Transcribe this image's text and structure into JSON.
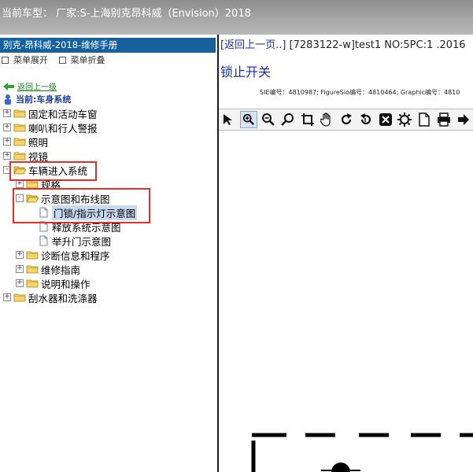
{
  "topbar": {
    "title": "当前车型： 厂家:S-上海别克昂科威（Envision）2018"
  },
  "left": {
    "manual_title": "别克-昂科威-2018-维修手册",
    "menu": [
      "菜单展开",
      "菜单折叠"
    ],
    "back_link": "返回上一级",
    "current": "当前:车身系统",
    "tree": [
      {
        "label": "固定和活动车窗",
        "level": 0,
        "type": "folder",
        "state": "+"
      },
      {
        "label": "喇叭和行人警报",
        "level": 0,
        "type": "folder",
        "state": "+"
      },
      {
        "label": "照明",
        "level": 0,
        "type": "folder",
        "state": "+"
      },
      {
        "label": "视镜",
        "level": 0,
        "type": "folder",
        "state": "+"
      },
      {
        "label": "车辆进入系统",
        "level": 0,
        "type": "folder-open",
        "state": "-"
      },
      {
        "label": "规格",
        "level": 1,
        "type": "folder",
        "state": "+"
      },
      {
        "label": "示意图和布线图",
        "level": 1,
        "type": "folder-open",
        "state": "-"
      },
      {
        "label": "门锁/指示灯示意图",
        "level": 2,
        "type": "doc",
        "state": ""
      },
      {
        "label": "释放系统示意图",
        "level": 2,
        "type": "doc",
        "state": ""
      },
      {
        "label": "举升门示意图",
        "level": 2,
        "type": "doc",
        "state": ""
      },
      {
        "label": "诊断信息和程序",
        "level": 1,
        "type": "folder",
        "state": "+"
      },
      {
        "label": "维修指南",
        "level": 1,
        "type": "folder",
        "state": "+"
      },
      {
        "label": "说明和操作",
        "level": 1,
        "type": "folder",
        "state": "+"
      },
      {
        "label": "刮水器和洗涤器",
        "level": 0,
        "type": "folder",
        "state": "+"
      }
    ]
  },
  "right": {
    "breadcrumb_back": "[返回上一页..]",
    "breadcrumb_id": " [7283122-w]test1 NO:5PC:1 .2016",
    "doc_title": "锁止开关",
    "meta": "SIE编号：4810987;  FigureSio编号：4810464;  Graphic编号：4810",
    "toolbar": [
      "pointer-icon",
      "zoom-in-icon",
      "zoom-out-icon",
      "magnify-icon",
      "crop-icon",
      "pan-hand-icon",
      "rotate-right-icon",
      "rotate-left-icon",
      "fit-icon",
      "settings-icon",
      "page-icon",
      "print-icon",
      "next-icon"
    ]
  },
  "colors": {
    "header_blue": "#16609c",
    "highlight_red": "#e0312b",
    "link_blue": "#1b2fa6",
    "back_green": "#1a7a1a"
  }
}
